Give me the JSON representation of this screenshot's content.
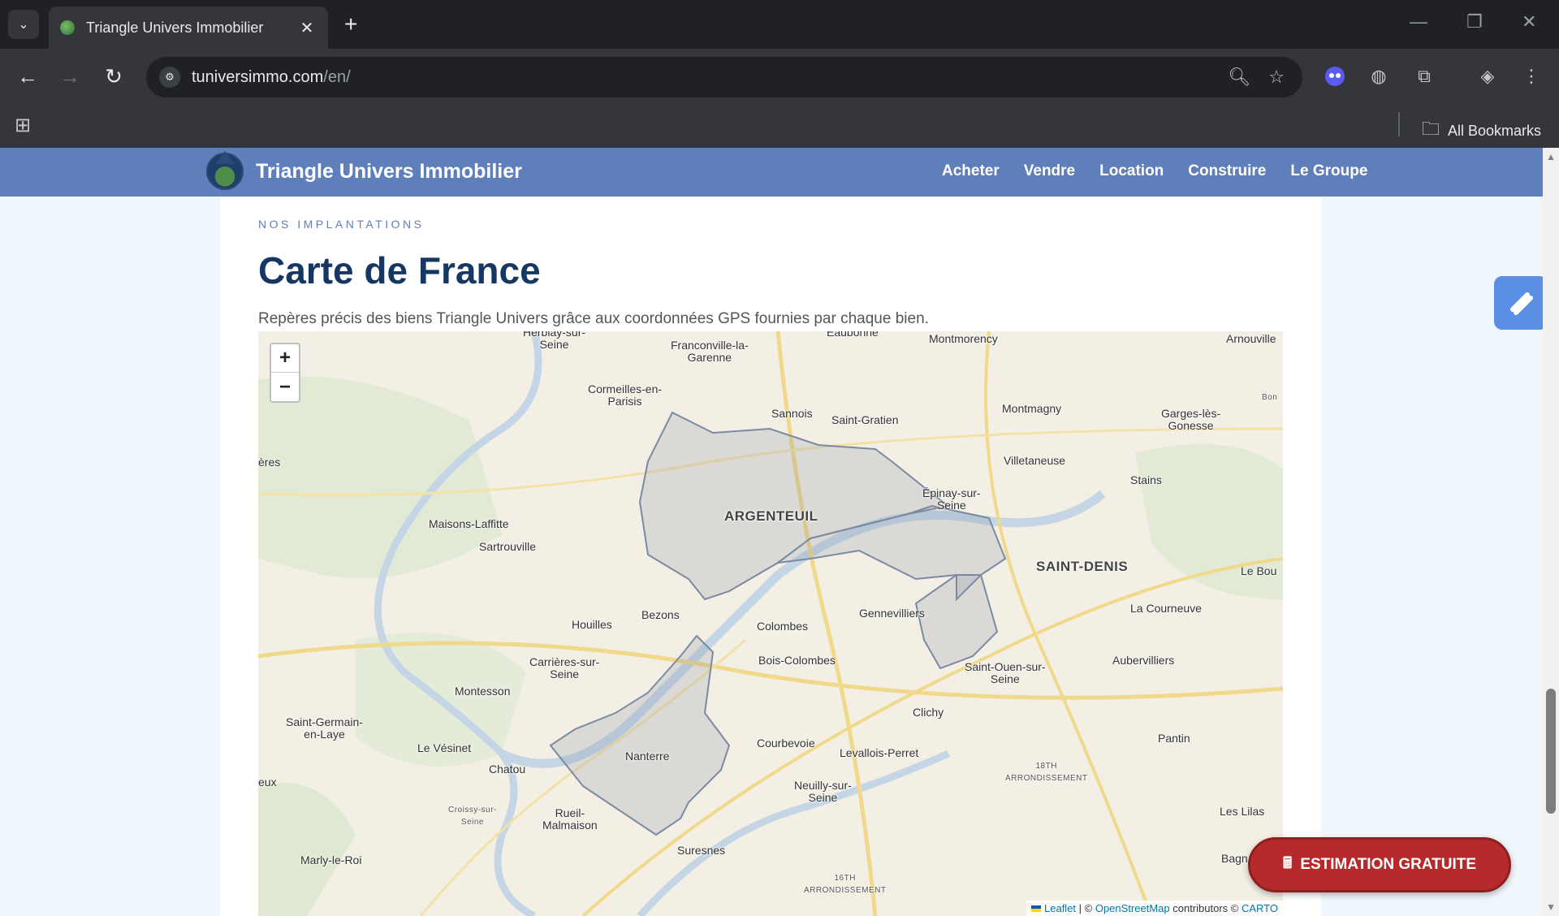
{
  "browser": {
    "tab_title": "Triangle Univers Immobilier",
    "tab_close": "✕",
    "new_tab": "+",
    "url_host": "tuniversimmo.com",
    "url_path": "/en/",
    "all_bookmarks": "All Bookmarks"
  },
  "site": {
    "brand": "Triangle Univers Immobilier",
    "menu": [
      "Acheter",
      "Vendre",
      "Location",
      "Construire",
      "Le Groupe"
    ]
  },
  "section": {
    "eyebrow": "NOS IMPLANTATIONS",
    "title": "Carte de France",
    "lead": "Repères précis des biens Triangle Univers grâce aux coordonnées GPS fournies par chaque bien."
  },
  "map": {
    "zoom_in": "+",
    "zoom_out": "−",
    "attribution": {
      "leaflet": "Leaflet",
      "sep": " | © ",
      "osm": "OpenStreetMap",
      "contrib": " contributors © ",
      "carto": "CARTO"
    },
    "places": [
      "Herblay-sur- Seine",
      "Franconville-la- Garenne",
      "Eaubonne",
      "Montmorency",
      "Arnouville",
      "Cormeilles-en- Parisis",
      "Sannois",
      "Saint-Gratien",
      "Montmagny",
      "Garges-lès- Gonesse",
      "Bon",
      "ères",
      "Villetaneuse",
      "Stains",
      "Épinay-sur- Seine",
      "ARGENTEUIL",
      "Maisons-Laffitte",
      "Sartrouville",
      "SAINT-DENIS",
      "Le Bou",
      "La Courneuve",
      "Houilles",
      "Bezons",
      "Colombes",
      "Gennevilliers",
      "Carrières-sur- Seine",
      "Bois-Colombes",
      "Saint-Ouen-sur- Seine",
      "Aubervilliers",
      "Montesson",
      "Saint-Germain- en-Laye",
      "Clichy",
      "Le Vésinet",
      "Courbevoie",
      "Levallois-Perret",
      "Pantin",
      "Nanterre",
      "Chatou",
      "18TH ARRONDISSEMENT",
      "eux",
      "Neuilly-sur- Seine",
      "Croissy-sur- Seine",
      "Rueil- Malmaison",
      "Les Lilas",
      "Suresnes",
      "Marly-le-Roi",
      "16TH ARRONDISSEMENT",
      "Bagn"
    ]
  },
  "cta": {
    "label": "ESTIMATION GRATUITE"
  },
  "colors": {
    "header": "#5e7fba",
    "title": "#173763",
    "cta": "#b52a2a"
  }
}
